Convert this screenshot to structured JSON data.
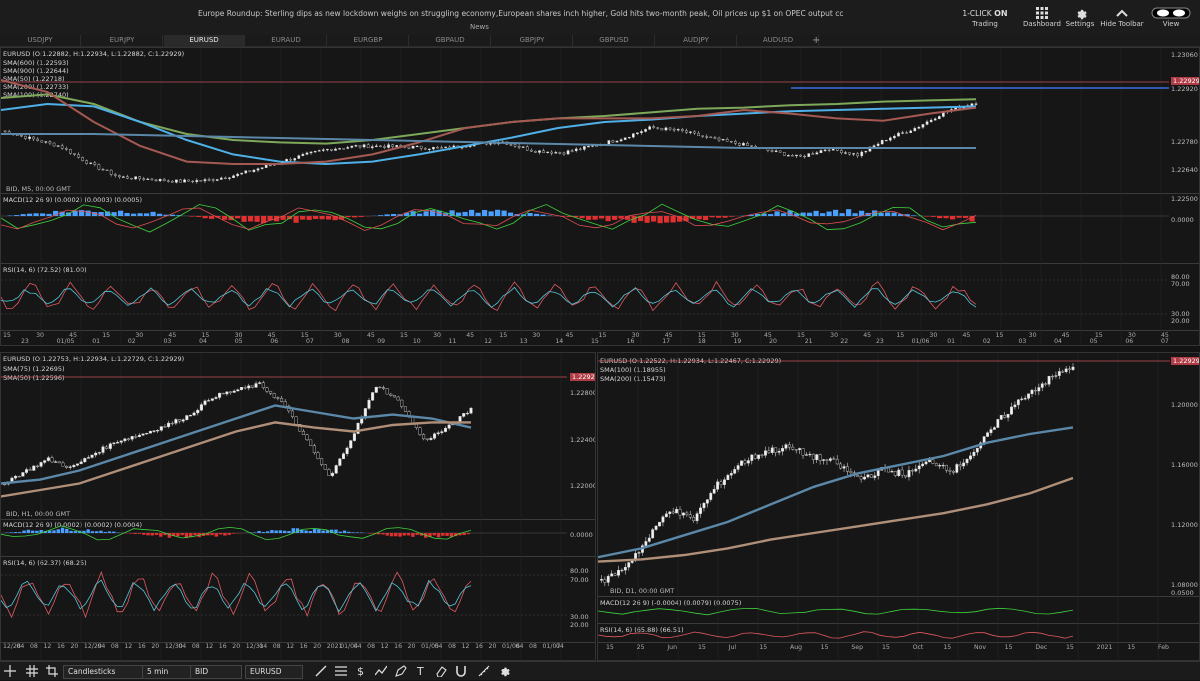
{
  "news": {
    "ticker": "Europe Roundup: Sterling dips as new lockdown weighs on struggling economy,European shares inch higher, Gold hits two-month peak, Oil prices up $1 on OPEC output cc",
    "label": "News"
  },
  "toolbar": {
    "oneclick_text": "1-CLICK",
    "oneclick_state": "ON",
    "trading_label": "Trading",
    "dashboard_label": "Dashboard",
    "settings_label": "Settings",
    "hide_toolbar_label": "Hide Toolbar",
    "view_label": "View"
  },
  "tabs": [
    "USDJPY",
    "EURJPY",
    "EURUSD",
    "EURAUD",
    "EURGBP",
    "GBPAUD",
    "GBPJPY",
    "GBPUSD",
    "AUDJPY",
    "AUDUSD"
  ],
  "active_tab": "EURUSD",
  "add_tab": "+",
  "colors": {
    "bull": "#4aa0ff",
    "bear": "#e03030",
    "sma_green": "#7ea85a",
    "sma_blue": "#4fb0e8",
    "sma_brown": "#a45a52",
    "sma_steel": "#5b88a8",
    "rsi_red": "#e05a60",
    "rsi_cyan": "#52c7d9",
    "macd_green": "#3ed23e"
  },
  "chart_top": {
    "ohlc": "EURUSD (O:1.22882, H:1.22934, L:1.22882, C:1.22929)",
    "sma_labels": [
      "SMA(600) (1.22593)",
      "SMA(900) (1.22644)",
      "SMA(50) (1.22718)",
      "SMA(200) (1.22733)",
      "SMA(100) (1.22740)"
    ],
    "feed": "BID, M5, 00:00 GMT",
    "macd": "MACD(12 26 9) (0.0002) (0.0003) (0.0005)",
    "rsi": "RSI(14, 6) (72.52) (81.00)",
    "price_ticks": [
      "1.23060",
      "1.22929",
      "1.22920",
      "1.22780",
      "1.22640",
      "1.22500"
    ],
    "macd_zero": "0.0000",
    "rsi_levels": [
      "80.00",
      "70.00",
      "30.00",
      "20.00"
    ],
    "time_ticks_minor": [
      "15",
      "30",
      "45",
      "15",
      "30",
      "45",
      "15",
      "30",
      "45",
      "15",
      "30",
      "45",
      "15",
      "30",
      "45",
      "15",
      "30",
      "45",
      "15",
      "30",
      "45",
      "15",
      "30",
      "45",
      "15",
      "30",
      "45",
      "15",
      "30",
      "45",
      "15",
      "30",
      "45",
      "15",
      "30",
      "45"
    ],
    "time_ticks_major": [
      "23",
      "01/05",
      "01",
      "02",
      "03",
      "04",
      "05",
      "06",
      "07",
      "08",
      "09",
      "10",
      "11",
      "12",
      "13",
      "14",
      "15",
      "16",
      "17",
      "18",
      "19",
      "20",
      "21",
      "22",
      "23",
      "01/06",
      "01",
      "02",
      "03",
      "04",
      "05",
      "06",
      "07"
    ]
  },
  "chart_bl": {
    "ohlc": "EURUSD (O:1.22753, H:1.22934, L:1.22729, C:1.22929)",
    "sma_labels": [
      "SMA(75) (1.22695)",
      "SMA(50) (1.22596)"
    ],
    "feed": "BID, H1, 00:00 GMT",
    "macd": "MACD(12 26 9) (0.0002) (0.0002) (0.0004)",
    "rsi": "RSI(14, 6) (62.37) (68.25)",
    "price_ticks": [
      "1.22929",
      "1.22800",
      "1.22400",
      "1.22000"
    ],
    "macd_zero": "0.0000",
    "rsi_levels": [
      "80.00",
      "70.00",
      "30.00",
      "20.00"
    ],
    "time_ticks": [
      "12/28",
      "04",
      "08",
      "12",
      "16",
      "20",
      "12/29",
      "04",
      "08",
      "12",
      "16",
      "20",
      "12/30",
      "04",
      "08",
      "12",
      "16",
      "20",
      "12/31",
      "04",
      "08",
      "12",
      "16",
      "20",
      "2021",
      "01/04",
      "04",
      "08",
      "12",
      "16",
      "20",
      "01/05",
      "04",
      "08",
      "12",
      "16",
      "20",
      "01/06",
      "04",
      "08",
      "01/07",
      "04"
    ]
  },
  "chart_br": {
    "ohlc": "EURUSD (O:1.22522, H:1.22934, L:1.22467, C:1.22929)",
    "sma_labels": [
      "SMA(100) (1.18955)",
      "SMA(200) (1.15473)"
    ],
    "feed": "BID, D1, 00:00 GMT",
    "macd": "MACD(12 26 9) (-0.0004) (0.0079) (0.0075)",
    "rsi": "RSI(14, 6) (65.88) (66.51)",
    "price_ticks": [
      "1.22929",
      "1.20000",
      "1.16000",
      "1.12000",
      "1.08000",
      "0.0500"
    ],
    "time_ticks": [
      "15",
      "25",
      "Jun",
      "15",
      "Jul",
      "15",
      "Aug",
      "15",
      "Sep",
      "15",
      "Oct",
      "15",
      "Nov",
      "15",
      "Dec",
      "15",
      "2021",
      "15",
      "Feb"
    ]
  },
  "bottom": {
    "chart_type": "Candlesticks",
    "period": "5 min",
    "side": "BID",
    "symbol": "EURUSD"
  }
}
